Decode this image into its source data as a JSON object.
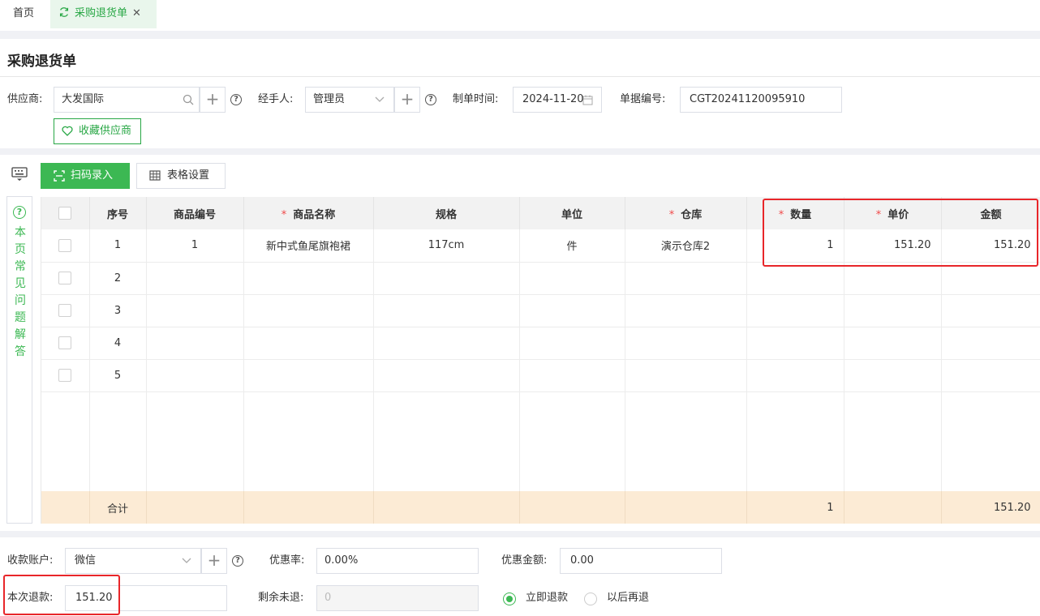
{
  "tabs": {
    "home": "首页",
    "active": "采购退货单"
  },
  "page": {
    "title": "采购退货单"
  },
  "form": {
    "supplier_label": "供应商:",
    "supplier_value": "大发国际",
    "handler_label": "经手人:",
    "handler_value": "管理员",
    "date_label": "制单时间:",
    "date_value": "2024-11-20",
    "docno_label": "单据编号:",
    "docno_value": "CGT20241120095910",
    "fav_supplier": "收藏供应商"
  },
  "toolbar": {
    "scan": "扫码录入",
    "table_settings": "表格设置"
  },
  "faq": {
    "text": "本页常见问题解答"
  },
  "table": {
    "headers": {
      "index": "序号",
      "code": "商品编号",
      "name": "商品名称",
      "spec": "规格",
      "unit": "单位",
      "warehouse": "仓库",
      "qty": "数量",
      "price": "单价",
      "amount": "金额"
    },
    "required_mark": "*",
    "rows": [
      {
        "index": "1",
        "code": "1",
        "name": "新中式鱼尾旗袍裙",
        "spec": "117cm",
        "unit": "件",
        "warehouse": "演示仓库2",
        "qty": "1",
        "price": "151.20",
        "amount": "151.20"
      },
      {
        "index": "2",
        "code": "",
        "name": "",
        "spec": "",
        "unit": "",
        "warehouse": "",
        "qty": "",
        "price": "",
        "amount": ""
      },
      {
        "index": "3",
        "code": "",
        "name": "",
        "spec": "",
        "unit": "",
        "warehouse": "",
        "qty": "",
        "price": "",
        "amount": ""
      },
      {
        "index": "4",
        "code": "",
        "name": "",
        "spec": "",
        "unit": "",
        "warehouse": "",
        "qty": "",
        "price": "",
        "amount": ""
      },
      {
        "index": "5",
        "code": "",
        "name": "",
        "spec": "",
        "unit": "",
        "warehouse": "",
        "qty": "",
        "price": "",
        "amount": ""
      }
    ],
    "total": {
      "label": "合计",
      "qty": "1",
      "amount": "151.20"
    }
  },
  "footer": {
    "account_label": "收款账户:",
    "account_value": "微信",
    "discount_rate_label": "优惠率:",
    "discount_rate_value": "0.00%",
    "discount_amount_label": "优惠金额:",
    "discount_amount_value": "0.00",
    "refund_label": "本次退款:",
    "refund_value": "151.20",
    "remaining_label": "剩余未退:",
    "remaining_placeholder": "0",
    "refund_now": "立即退款",
    "refund_later": "以后再退"
  },
  "colors": {
    "accent": "#3cb853",
    "highlight": "#e8262a",
    "total_row": "#fcebd5"
  }
}
